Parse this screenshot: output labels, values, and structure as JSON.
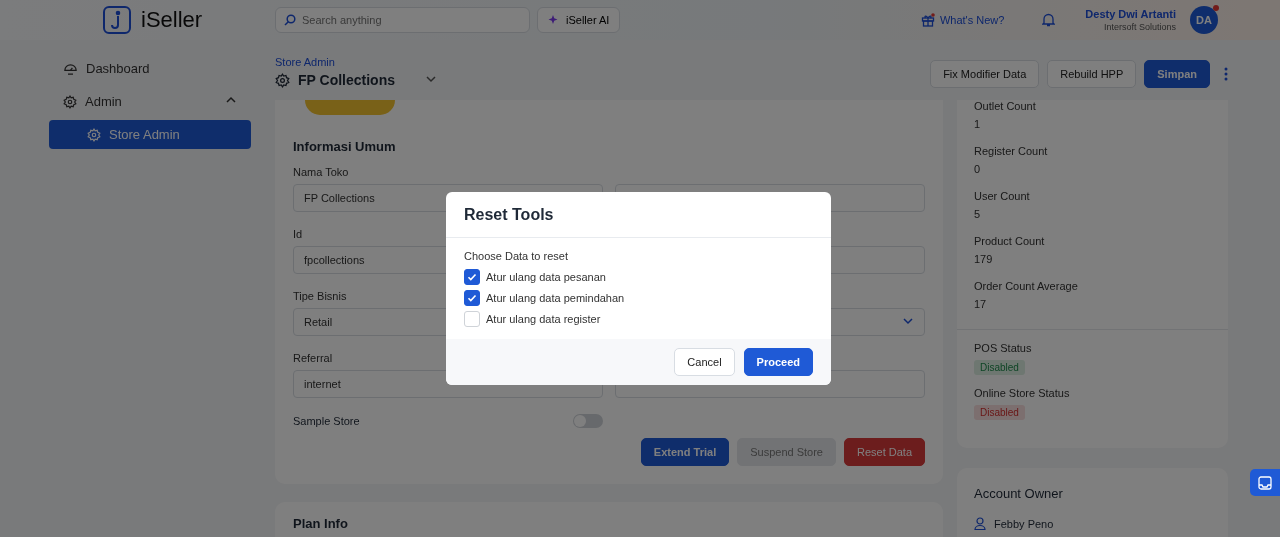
{
  "header": {
    "logo": "iSeller",
    "search": {
      "placeholder": "Search anything"
    },
    "ai_button": "iSeller AI",
    "whats_new": "What's New?",
    "user": {
      "name": "Desty Dwi Artanti",
      "company": "Intersoft Solutions",
      "initials": "DA"
    }
  },
  "sidebar": {
    "items": [
      {
        "label": "Dashboard",
        "selected": false
      },
      {
        "label": "Admin",
        "selected": false,
        "expanded": true,
        "children": [
          {
            "label": "Store Admin",
            "selected": true
          }
        ]
      }
    ]
  },
  "page": {
    "breadcrumb": "Store Admin",
    "title": "FP Collections",
    "actions": [
      {
        "label": "Fix Modifier Data",
        "kind": "secondary"
      },
      {
        "label": "Rebuild HPP",
        "kind": "secondary"
      },
      {
        "label": "Simpan",
        "kind": "primary"
      }
    ]
  },
  "general": {
    "title": "Informasi Umum",
    "rows": [
      {
        "label": "Nama Toko",
        "value": "FP Collections",
        "kind": "text"
      },
      {
        "label": "Id",
        "value": "fpcollections",
        "kind": "text"
      },
      {
        "label": "Tipe Bisnis",
        "value": "Retail",
        "kind": "select"
      },
      {
        "label": "Referral",
        "value": "internet",
        "kind": "text"
      }
    ],
    "toggle": {
      "label": "Sample Store",
      "on": false
    },
    "buttons": [
      {
        "label": "Extend Trial",
        "kind": "primary"
      },
      {
        "label": "Suspend Store",
        "kind": "muted"
      },
      {
        "label": "Reset Data",
        "kind": "danger"
      }
    ]
  },
  "plan_info": {
    "title": "Plan Info"
  },
  "stats": [
    {
      "label": "Outlet Count",
      "value": "1"
    },
    {
      "label": "Register Count",
      "value": "0"
    },
    {
      "label": "User Count",
      "value": "5"
    },
    {
      "label": "Product Count",
      "value": "179"
    },
    {
      "label": "Order Count Average",
      "value": "17"
    }
  ],
  "statuses": [
    {
      "label": "POS Status",
      "value": "Disabled",
      "kind": "success"
    },
    {
      "label": "Online Store Status",
      "value": "Disabled",
      "kind": "danger"
    }
  ],
  "account_owner": {
    "title": "Account Owner",
    "name": "Febby Peno"
  },
  "modal": {
    "title": "Reset Tools",
    "subtitle": "Choose Data to reset",
    "options": [
      {
        "label": "Atur ulang data pesanan",
        "checked": true
      },
      {
        "label": "Atur ulang data pemindahan",
        "checked": true
      },
      {
        "label": "Atur ulang data register",
        "checked": false
      }
    ],
    "buttons": [
      {
        "label": "Cancel",
        "kind": "secondary"
      },
      {
        "label": "Proceed",
        "kind": "primary"
      }
    ]
  }
}
